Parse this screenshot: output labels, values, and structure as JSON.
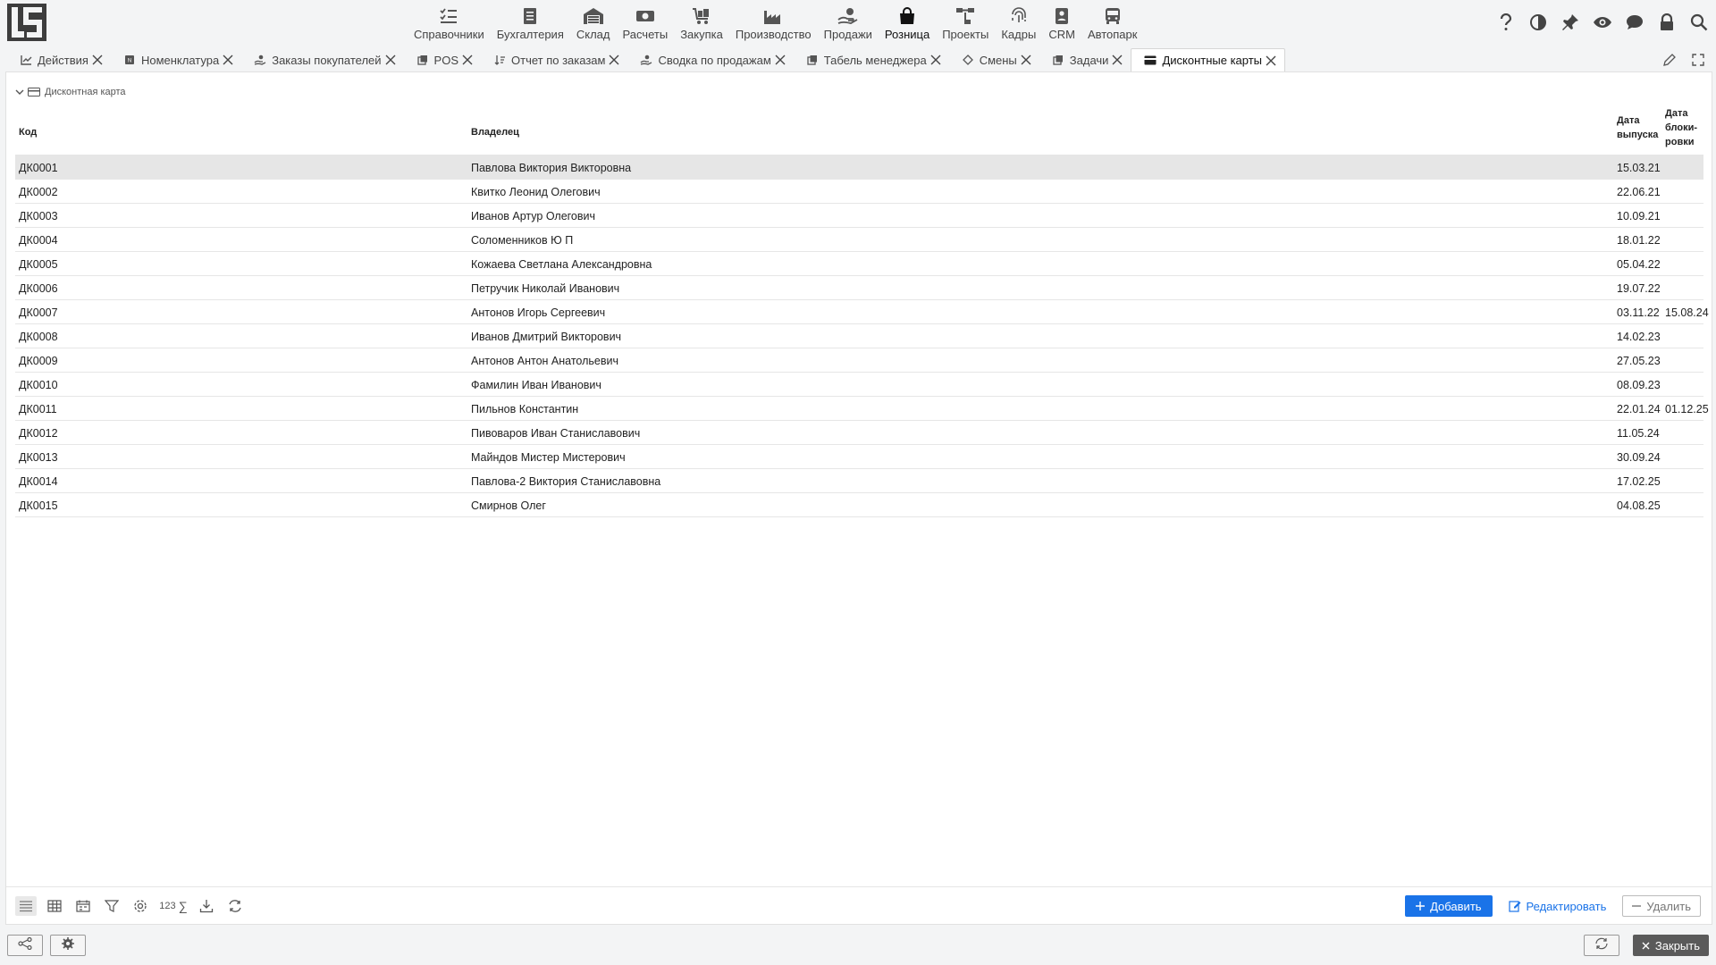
{
  "menu": [
    {
      "label": "Справочники",
      "icon": "list-check-icon"
    },
    {
      "label": "Бухгалтерия",
      "icon": "ledger-icon"
    },
    {
      "label": "Склад",
      "icon": "warehouse-icon"
    },
    {
      "label": "Расчеты",
      "icon": "money-icon"
    },
    {
      "label": "Закупка",
      "icon": "cart-icon"
    },
    {
      "label": "Производство",
      "icon": "factory-icon"
    },
    {
      "label": "Продажи",
      "icon": "hand-coin-icon"
    },
    {
      "label": "Розница",
      "icon": "shopping-bag-icon",
      "active": true
    },
    {
      "label": "Проекты",
      "icon": "project-icon"
    },
    {
      "label": "Кадры",
      "icon": "fingerprint-icon"
    },
    {
      "label": "CRM",
      "icon": "contact-card-icon"
    },
    {
      "label": "Автопарк",
      "icon": "bus-icon"
    }
  ],
  "tabs": [
    {
      "label": "Действия",
      "icon": "chart-icon"
    },
    {
      "label": "Номенклатура",
      "icon": "nomenclature-icon"
    },
    {
      "label": "Заказы покупателей",
      "icon": "hand-coin-icon"
    },
    {
      "label": "POS",
      "icon": "copy-icon"
    },
    {
      "label": "Отчет по заказам",
      "icon": "sort-icon"
    },
    {
      "label": "Сводка по продажам",
      "icon": "hand-coin-icon"
    },
    {
      "label": "Табель менеджера",
      "icon": "copy-icon"
    },
    {
      "label": "Смены",
      "icon": "shift-icon"
    },
    {
      "label": "Задачи",
      "icon": "copy-icon"
    },
    {
      "label": "Дисконтные карты",
      "icon": "credit-card-icon",
      "active": true
    }
  ],
  "section": {
    "title": "Дисконтная карта"
  },
  "table": {
    "headers": {
      "code": "Код",
      "owner": "Владелец",
      "issue_l1": "Дата",
      "issue_l2": "выпуска",
      "block_l1": "Дата",
      "block_l2": "блоки-",
      "block_l3": "ровки"
    },
    "rows": [
      {
        "code": "ДК0001",
        "owner": "Павлова Виктория Викторовна",
        "issue": "15.03.21",
        "block": ""
      },
      {
        "code": "ДК0002",
        "owner": "Квитко Леонид Олегович",
        "issue": "22.06.21",
        "block": ""
      },
      {
        "code": "ДК0003",
        "owner": "Иванов Артур Олегович",
        "issue": "10.09.21",
        "block": ""
      },
      {
        "code": "ДК0004",
        "owner": "Соломенников Ю П",
        "issue": "18.01.22",
        "block": ""
      },
      {
        "code": "ДК0005",
        "owner": "Кожаева Светлана Александровна",
        "issue": "05.04.22",
        "block": ""
      },
      {
        "code": "ДК0006",
        "owner": "Петручик Николай Иванович",
        "issue": "19.07.22",
        "block": ""
      },
      {
        "code": "ДК0007",
        "owner": "Антонов Игорь Сергеевич",
        "issue": "03.11.22",
        "block": "15.08.24"
      },
      {
        "code": "ДК0008",
        "owner": "Иванов Дмитрий Викторович",
        "issue": "14.02.23",
        "block": ""
      },
      {
        "code": "ДК0009",
        "owner": "Антонов Антон Анатольевич",
        "issue": "27.05.23",
        "block": ""
      },
      {
        "code": "ДК0010",
        "owner": "Фамилин Иван Иванович",
        "issue": "08.09.23",
        "block": ""
      },
      {
        "code": "ДК0011",
        "owner": "Пильнов Константин",
        "issue": "22.01.24",
        "block": "01.12.25"
      },
      {
        "code": "ДК0012",
        "owner": "Пивоваров Иван Станиславович",
        "issue": "11.05.24",
        "block": ""
      },
      {
        "code": "ДК0013",
        "owner": "Майндов Мистер Мистерович",
        "issue": "30.09.24",
        "block": ""
      },
      {
        "code": "ДК0014",
        "owner": "Павлова-2 Виктория Станиславовна",
        "issue": "17.02.25",
        "block": ""
      },
      {
        "code": "ДК0015",
        "owner": "Смирнов Олег",
        "issue": "04.08.25",
        "block": ""
      }
    ]
  },
  "toolbar": {
    "sum_label": "123",
    "sigma": "∑"
  },
  "actions": {
    "add": "Добавить",
    "edit": "Редактировать",
    "delete": "Удалить",
    "close": "Закрыть"
  },
  "colors": {
    "accent": "#1a73e8",
    "selected_row": "#e6e6e6",
    "close_button": "#5a5a5a"
  }
}
